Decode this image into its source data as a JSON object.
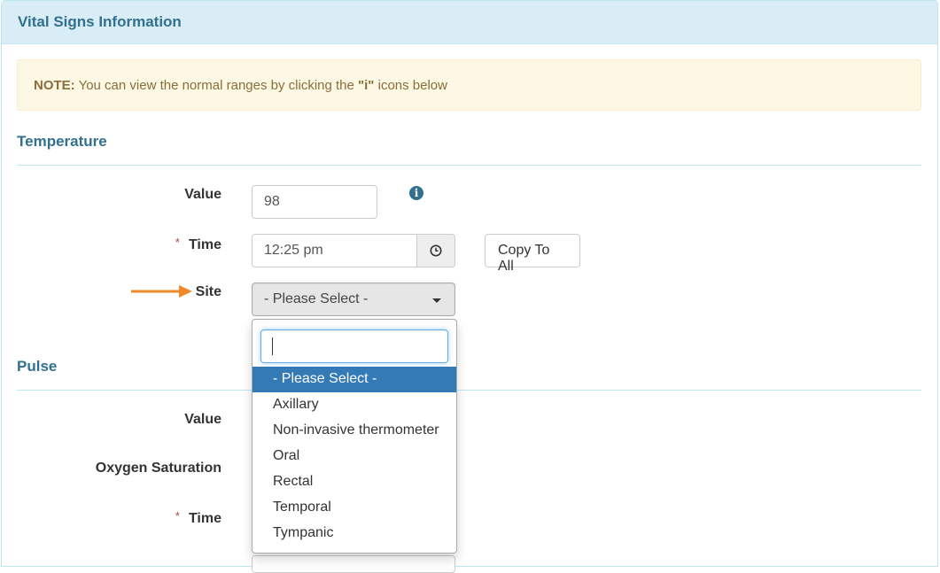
{
  "panel": {
    "title": "Vital Signs Information"
  },
  "note": {
    "prefix": "NOTE:",
    "text_before": " You can view the normal ranges by clicking the ",
    "highlight": "\"i\"",
    "text_after": " icons below"
  },
  "temperature": {
    "title": "Temperature",
    "value_label": "Value",
    "value": "98",
    "info_icon": "info-circle-icon",
    "time_label": "Time",
    "time_required": "*",
    "time_value": "12:25 pm",
    "clock_icon": "clock-icon",
    "copy_button": "Copy To All",
    "site_label": "Site",
    "site_selected": "- Please Select -"
  },
  "site_dropdown": {
    "search_value": "",
    "options": [
      {
        "label": "- Please Select -",
        "highlighted": true
      },
      {
        "label": "Axillary",
        "highlighted": false
      },
      {
        "label": "Non-invasive thermometer",
        "highlighted": false
      },
      {
        "label": "Oral",
        "highlighted": false
      },
      {
        "label": "Rectal",
        "highlighted": false
      },
      {
        "label": "Temporal",
        "highlighted": false
      },
      {
        "label": "Tympanic",
        "highlighted": false
      }
    ]
  },
  "pulse": {
    "title": "Pulse",
    "value_label": "Value",
    "oxygen_label": "Oxygen Saturation",
    "time_label": "Time",
    "time_required": "*"
  },
  "colors": {
    "heading_bg": "#d9edf7",
    "heading_text": "#31708f",
    "note_bg": "#fcf8e3",
    "note_text": "#8a6d3b",
    "highlight": "#337ab7",
    "arrow": "#f0892a",
    "required": "#a94442"
  }
}
